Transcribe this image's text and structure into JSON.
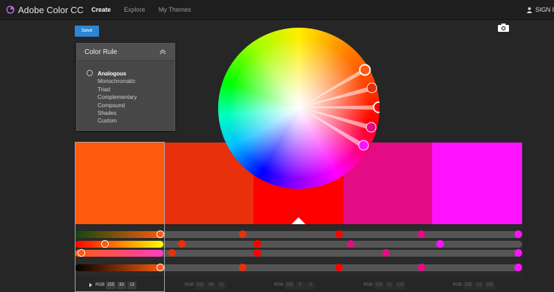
{
  "app": {
    "title": "Adobe Color CC",
    "nav": [
      "Create",
      "Explore",
      "My Themes"
    ],
    "active_nav": "Create",
    "signin": "SIGN I"
  },
  "toolbar": {
    "save_label": "Save",
    "camera_icon": "camera-icon"
  },
  "color_rule": {
    "title": "Color Rule",
    "options": [
      "Analogous",
      "Monochromatic",
      "Triad",
      "Complementary",
      "Compound",
      "Shades",
      "Custom"
    ],
    "selected": "Analogous"
  },
  "swatches": [
    {
      "color": "#ff5a0d"
    },
    {
      "color": "#e8300c"
    },
    {
      "color": "#ff0000"
    },
    {
      "color": "#e40c84"
    },
    {
      "color": "#ff13ff"
    }
  ],
  "rgb": [
    {
      "label": "RGB",
      "values": [
        "255",
        "83",
        "13"
      ]
    },
    {
      "label": "RGB",
      "values": [
        "232",
        "44",
        "12"
      ]
    },
    {
      "label": "RGB",
      "values": [
        "255",
        "0",
        "0"
      ]
    },
    {
      "label": "RGB",
      "values": [
        "228",
        "12",
        "132"
      ]
    },
    {
      "label": "RGB",
      "values": [
        "255",
        "13",
        "255"
      ]
    }
  ],
  "colors": {
    "accent": "#2d86d5",
    "background": "#262626"
  }
}
